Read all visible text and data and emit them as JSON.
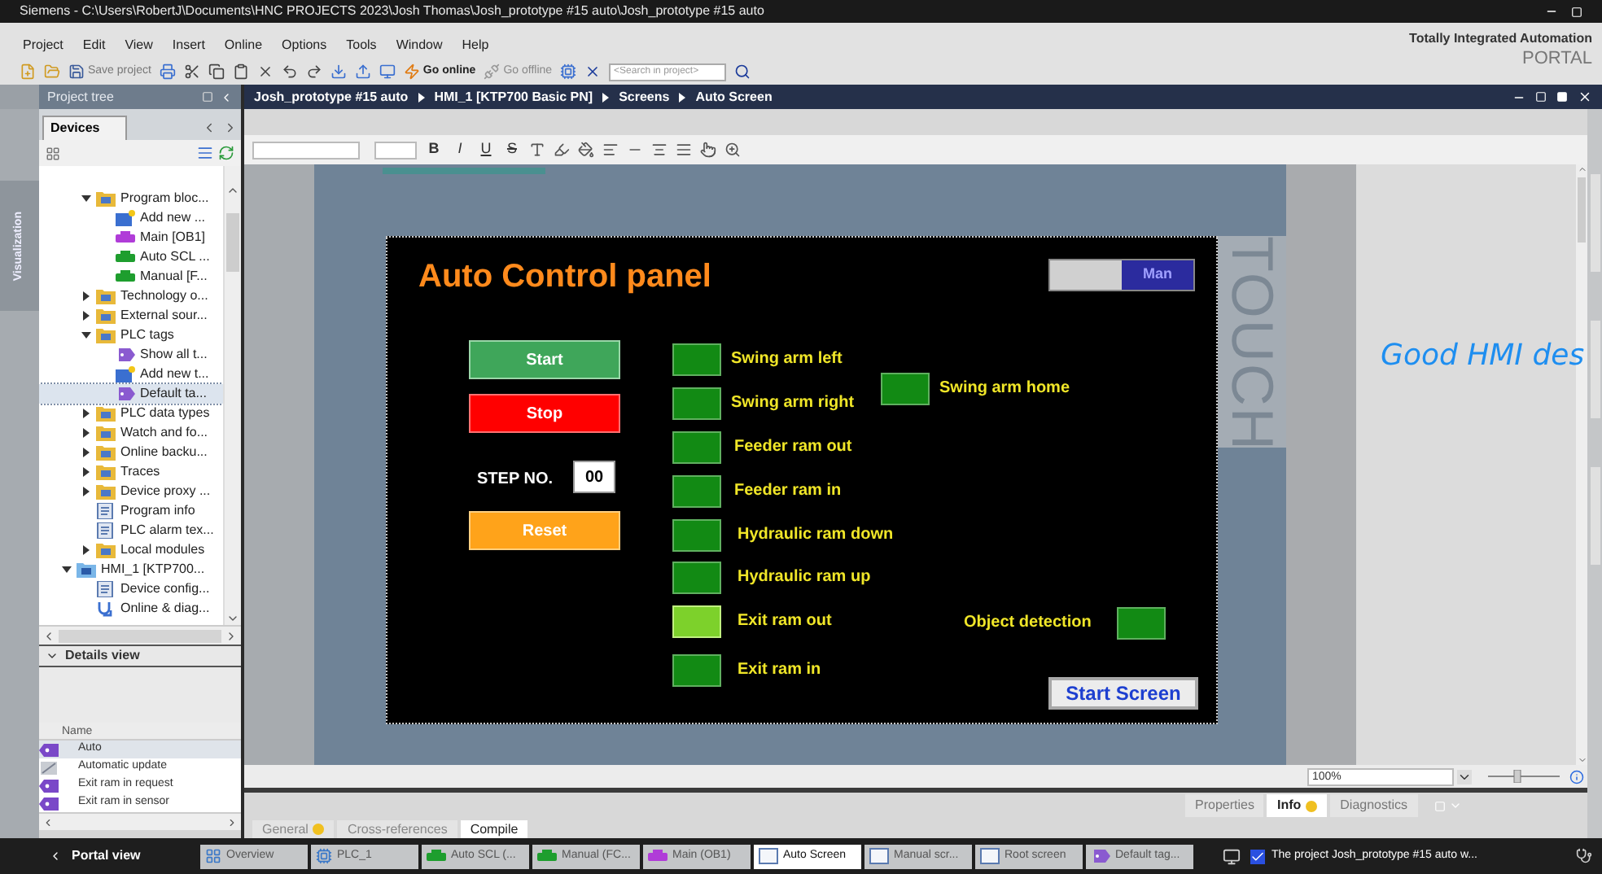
{
  "window": {
    "title": "Siemens  -  C:\\Users\\RobertJ\\Documents\\HNC PROJECTS 2023\\Josh Thomas\\Josh_prototype #15 auto\\Josh_prototype #15 auto"
  },
  "menu": [
    "Project",
    "Edit",
    "View",
    "Insert",
    "Online",
    "Options",
    "Tools",
    "Window",
    "Help"
  ],
  "toolbar": {
    "save": "Save project",
    "go_online": "Go online",
    "go_offline": "Go offline",
    "search": {
      "placeholder": "<Search in project>"
    }
  },
  "brand": {
    "line_1": "Totally Integrated Automation",
    "line_2": "PORTAL"
  },
  "side_tab": "Visualization",
  "project_tree": {
    "title": "Project tree",
    "tab": "Devices",
    "plc_children": [
      {
        "label": "Program bloc...",
        "kind": "folder",
        "expanded": true,
        "selected": false,
        "children": [
          {
            "label": "Add new ...",
            "kind": "add",
            "selected": false
          },
          {
            "label": "Main [OB1]",
            "kind": "block",
            "color": "#b03cd8",
            "selected": false
          },
          {
            "label": "Auto SCL ...",
            "kind": "block",
            "color": "#1e9e2e",
            "selected": false
          },
          {
            "label": "Manual [F...",
            "kind": "block",
            "color": "#1e9e2e",
            "selected": false
          }
        ]
      },
      {
        "label": "Technology o...",
        "kind": "folder",
        "expanded": false,
        "selected": false
      },
      {
        "label": "External sour...",
        "kind": "folder",
        "expanded": false,
        "selected": false
      },
      {
        "label": "PLC tags",
        "kind": "folder",
        "expanded": true,
        "selected": false,
        "children": [
          {
            "label": "Show all t...",
            "kind": "tags",
            "selected": false
          },
          {
            "label": "Add new t...",
            "kind": "add",
            "selected": false
          },
          {
            "label": "Default ta...",
            "kind": "tags",
            "selected": true
          }
        ]
      },
      {
        "label": "PLC data types",
        "kind": "folder",
        "expanded": false,
        "selected": false
      },
      {
        "label": "Watch and fo...",
        "kind": "folder",
        "expanded": false,
        "selected": false
      },
      {
        "label": "Online backu...",
        "kind": "folder",
        "expanded": false,
        "selected": false
      },
      {
        "label": "Traces",
        "kind": "folder",
        "expanded": false,
        "selected": false
      },
      {
        "label": "Device proxy ...",
        "kind": "folder",
        "expanded": false,
        "selected": false
      },
      {
        "label": "Program info",
        "kind": "doc",
        "selected": false
      },
      {
        "label": "PLC alarm tex...",
        "kind": "doc",
        "selected": false
      },
      {
        "label": "Local modules",
        "kind": "folder",
        "expanded": false,
        "selected": false
      }
    ],
    "devices": [
      {
        "label": "HMI_1 [KTP700...",
        "kind": "device",
        "expanded": true,
        "selected": false,
        "children": [
          {
            "label": "Device config...",
            "kind": "doc",
            "selected": false
          },
          {
            "label": "Online & diag...",
            "kind": "diag",
            "selected": false
          }
        ]
      }
    ]
  },
  "details_view": {
    "title": "Details view",
    "column": "Name",
    "rows": [
      {
        "name": "Auto",
        "kind": "tag",
        "selected": true
      },
      {
        "name": "Automatic update",
        "kind": "update",
        "selected": false
      },
      {
        "name": "Exit ram in request",
        "kind": "tag",
        "selected": false
      },
      {
        "name": "Exit ram in sensor",
        "kind": "tag",
        "selected": false
      }
    ]
  },
  "editor": {
    "breadcrumb": [
      "Josh_prototype #15 auto",
      "HMI_1 [KTP700 Basic PN]",
      "Screens",
      "Auto Screen"
    ],
    "format_buttons": [
      "B",
      "I",
      "U",
      "S"
    ],
    "device_label": "TOUCH",
    "zoom": "100%",
    "zoom_slider": {
      "level": 0.4
    },
    "hmi": {
      "title": "Auto Control panel",
      "mode_switch": {
        "label": "Man",
        "on": true
      },
      "buttons": [
        {
          "label": "Start",
          "kind": "start"
        },
        {
          "label": "Stop",
          "kind": "stop"
        },
        {
          "label": "Reset",
          "kind": "reset"
        }
      ],
      "step": {
        "label": "STEP NO.",
        "value": "00"
      },
      "indicators": [
        {
          "label": "Swing arm left",
          "on": false
        },
        {
          "label": "Swing arm right",
          "on": false
        },
        {
          "label": "Swing arm home",
          "on": false
        },
        {
          "label": "Feeder ram out",
          "on": false
        },
        {
          "label": "Feeder ram in",
          "on": false
        },
        {
          "label": "Hydraulic ram down",
          "on": false
        },
        {
          "label": "Hydraulic ram up",
          "on": false
        },
        {
          "label": "Exit ram out",
          "on": true
        },
        {
          "label": "Object detection",
          "on": false
        },
        {
          "label": "Exit ram in",
          "on": false
        }
      ],
      "nav_button": "Start Screen"
    }
  },
  "caption": "Good HMI des",
  "inspector": {
    "tabs": [
      {
        "label": "Properties",
        "selected": false,
        "warning": false
      },
      {
        "label": "Info",
        "selected": true,
        "warning": true
      },
      {
        "label": "Diagnostics",
        "selected": false,
        "warning": false
      }
    ],
    "subtabs": [
      {
        "label": "General",
        "selected": false,
        "warning": true
      },
      {
        "label": "Cross-references",
        "selected": false,
        "warning": false
      },
      {
        "label": "Compile",
        "selected": true,
        "warning": false
      }
    ]
  },
  "taskbar": {
    "portal_view": "Portal view",
    "editors": [
      {
        "label": "Overview",
        "kind": "overview",
        "selected": false
      },
      {
        "label": "PLC_1",
        "kind": "plc",
        "selected": false
      },
      {
        "label": "Auto SCL (...",
        "kind": "block",
        "color": "#1e9e2e",
        "selected": false
      },
      {
        "label": "Manual (FC...",
        "kind": "block",
        "color": "#1e9e2e",
        "selected": false
      },
      {
        "label": "Main (OB1)",
        "kind": "block",
        "color": "#b03cd8",
        "selected": false
      },
      {
        "label": "Auto Screen",
        "kind": "screen",
        "selected": true
      },
      {
        "label": "Manual scr...",
        "kind": "screen",
        "selected": false
      },
      {
        "label": "Root screen",
        "kind": "screen",
        "selected": false
      },
      {
        "label": "Default tag...",
        "kind": "tags",
        "selected": false
      }
    ],
    "status": "The project Josh_prototype #15 auto w..."
  }
}
